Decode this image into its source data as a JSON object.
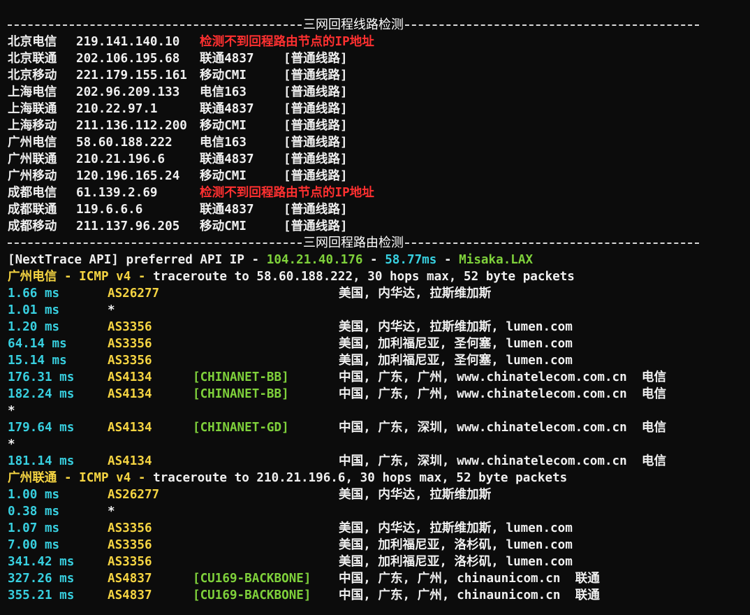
{
  "header_fragment": "",
  "section1": {
    "title": "三网回程线路检测",
    "rows": [
      {
        "city": "北京电信",
        "ip": "219.141.140.10",
        "route": "检测不到回程路由节点的IP地址",
        "type": "",
        "error": true
      },
      {
        "city": "北京联通",
        "ip": "202.106.195.68",
        "route": "联通4837",
        "type": "[普通线路]",
        "error": false
      },
      {
        "city": "北京移动",
        "ip": "221.179.155.161",
        "route": "移动CMI",
        "type": "[普通线路]",
        "error": false
      },
      {
        "city": "上海电信",
        "ip": "202.96.209.133",
        "route": "电信163",
        "type": "[普通线路]",
        "error": false
      },
      {
        "city": "上海联通",
        "ip": "210.22.97.1",
        "route": "联通4837",
        "type": "[普通线路]",
        "error": false
      },
      {
        "city": "上海移动",
        "ip": "211.136.112.200",
        "route": "移动CMI",
        "type": "[普通线路]",
        "error": false
      },
      {
        "city": "广州电信",
        "ip": "58.60.188.222",
        "route": "电信163",
        "type": "[普通线路]",
        "error": false
      },
      {
        "city": "广州联通",
        "ip": "210.21.196.6",
        "route": "联通4837",
        "type": "[普通线路]",
        "error": false
      },
      {
        "city": "广州移动",
        "ip": "120.196.165.24",
        "route": "移动CMI",
        "type": "[普通线路]",
        "error": false
      },
      {
        "city": "成都电信",
        "ip": "61.139.2.69",
        "route": "检测不到回程路由节点的IP地址",
        "type": "",
        "error": true
      },
      {
        "city": "成都联通",
        "ip": "119.6.6.6",
        "route": "联通4837",
        "type": "[普通线路]",
        "error": false
      },
      {
        "city": "成都移动",
        "ip": "211.137.96.205",
        "route": "移动CMI",
        "type": "[普通线路]",
        "error": false
      }
    ]
  },
  "section2": {
    "title": "三网回程路由检测",
    "api_line": {
      "prefix": "[NextTrace API] preferred API IP - ",
      "ip": "104.21.40.176",
      "sep1": " - ",
      "latency": "58.77ms",
      "sep2": " - ",
      "node": "Misaka.LAX"
    },
    "traces": [
      {
        "target": "广州电信",
        "proto": " - ICMP v4 - ",
        "desc": "traceroute to 58.60.188.222, 30 hops max, 52 byte packets",
        "hops": [
          {
            "time": "1.66 ms",
            "as": "AS26277",
            "tag": "",
            "geo": "美国, 内华达, 拉斯维加斯"
          },
          {
            "time": "1.01 ms",
            "as": "*",
            "tag": "",
            "geo": ""
          },
          {
            "time": "1.20 ms",
            "as": "AS3356",
            "tag": "",
            "geo": "美国, 内华达, 拉斯维加斯, lumen.com"
          },
          {
            "time": "64.14 ms",
            "as": "AS3356",
            "tag": "",
            "geo": "美国, 加利福尼亚, 圣何塞, lumen.com"
          },
          {
            "time": "15.14 ms",
            "as": "AS3356",
            "tag": "",
            "geo": "美国, 加利福尼亚, 圣何塞, lumen.com"
          },
          {
            "time": "176.31 ms",
            "as": "AS4134",
            "tag": "[CHINANET-BB]",
            "geo": "中国, 广东, 广州, www.chinatelecom.com.cn  电信"
          },
          {
            "time": "182.24 ms",
            "as": "AS4134",
            "tag": "[CHINANET-BB]",
            "geo": "中国, 广东, 广州, www.chinatelecom.com.cn  电信"
          },
          {
            "time": "*",
            "as": "",
            "tag": "",
            "geo": ""
          },
          {
            "time": "179.64 ms",
            "as": "AS4134",
            "tag": "[CHINANET-GD]",
            "geo": "中国, 广东, 深圳, www.chinatelecom.com.cn  电信"
          },
          {
            "time": "*",
            "as": "",
            "tag": "",
            "geo": ""
          },
          {
            "time": "181.14 ms",
            "as": "AS4134",
            "tag": "",
            "geo": "中国, 广东, 深圳, www.chinatelecom.com.cn  电信"
          }
        ]
      },
      {
        "target": "广州联通",
        "proto": " - ICMP v4 - ",
        "desc": "traceroute to 210.21.196.6, 30 hops max, 52 byte packets",
        "hops": [
          {
            "time": "1.00 ms",
            "as": "AS26277",
            "tag": "",
            "geo": "美国, 内华达, 拉斯维加斯"
          },
          {
            "time": "0.38 ms",
            "as": "*",
            "tag": "",
            "geo": ""
          },
          {
            "time": "1.07 ms",
            "as": "AS3356",
            "tag": "",
            "geo": "美国, 内华达, 拉斯维加斯, lumen.com"
          },
          {
            "time": "7.00 ms",
            "as": "AS3356",
            "tag": "",
            "geo": "美国, 加利福尼亚, 洛杉矶, lumen.com"
          },
          {
            "time": "341.42 ms",
            "as": "AS3356",
            "tag": "",
            "geo": "美国, 加利福尼亚, 洛杉矶, lumen.com"
          },
          {
            "time": "327.26 ms",
            "as": "AS4837",
            "tag": "[CU169-BACKBONE]",
            "geo": "中国, 广东, 广州, chinaunicom.cn  联通"
          },
          {
            "time": "355.21 ms",
            "as": "AS4837",
            "tag": "[CU169-BACKBONE]",
            "geo": "中国, 广东, 广州, chinaunicom.cn  联通"
          }
        ]
      }
    ]
  }
}
